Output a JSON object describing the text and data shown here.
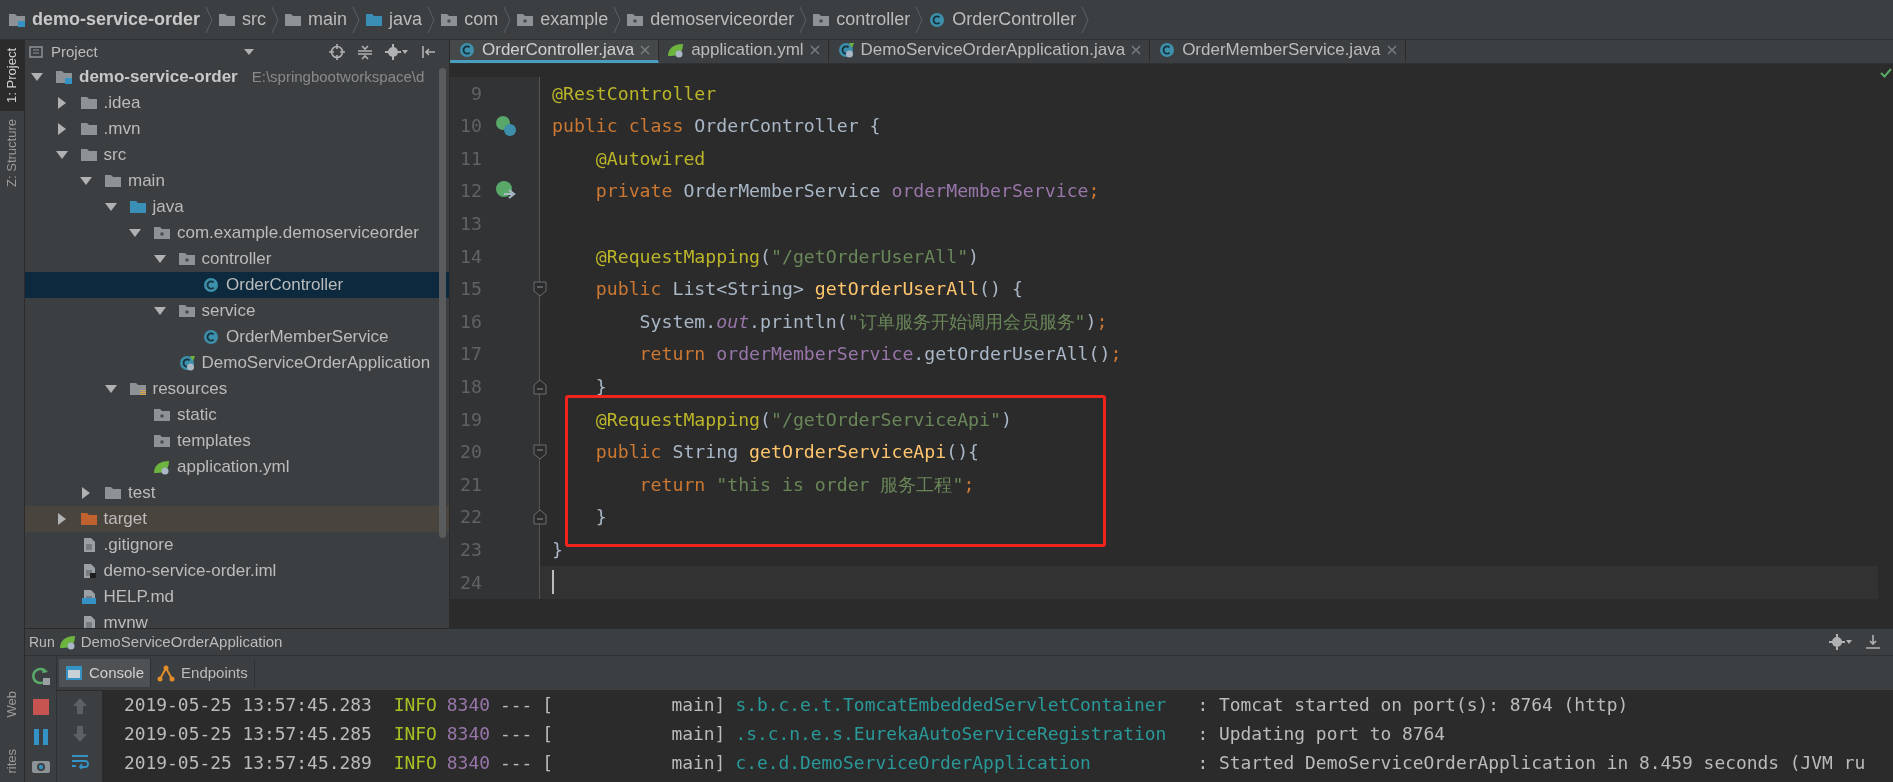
{
  "breadcrumbs": [
    {
      "label": "demo-service-order",
      "kind": "module"
    },
    {
      "label": "src",
      "kind": "folder"
    },
    {
      "label": "main",
      "kind": "folder"
    },
    {
      "label": "java",
      "kind": "source-folder"
    },
    {
      "label": "com",
      "kind": "package"
    },
    {
      "label": "example",
      "kind": "package"
    },
    {
      "label": "demoserviceorder",
      "kind": "package"
    },
    {
      "label": "controller",
      "kind": "package"
    },
    {
      "label": "OrderController",
      "kind": "class"
    }
  ],
  "tool_strip": {
    "top": [
      {
        "label": "1: Project",
        "selected": true
      },
      {
        "label": "Z: Structure",
        "selected": false
      }
    ],
    "bottom": [
      {
        "label": "Web",
        "selected": false
      },
      {
        "label": "rites",
        "selected": false
      }
    ]
  },
  "project": {
    "title": "Project",
    "tree": [
      {
        "label": "demo-service-order",
        "hint": "E:\\springbootworkspace\\d",
        "kind": "module",
        "expanded": true,
        "selected": false,
        "children": [
          {
            "label": ".idea",
            "kind": "folder",
            "expanded": false,
            "selected": false
          },
          {
            "label": ".mvn",
            "kind": "folder",
            "expanded": false,
            "selected": false
          },
          {
            "label": "src",
            "kind": "folder",
            "expanded": true,
            "selected": false,
            "children": [
              {
                "label": "main",
                "kind": "folder",
                "expanded": true,
                "selected": false,
                "children": [
                  {
                    "label": "java",
                    "kind": "source-folder",
                    "expanded": true,
                    "selected": false,
                    "children": [
                      {
                        "label": "com.example.demoserviceorder",
                        "kind": "package",
                        "expanded": true,
                        "selected": false,
                        "children": [
                          {
                            "label": "controller",
                            "kind": "package",
                            "expanded": true,
                            "selected": false,
                            "children": [
                              {
                                "label": "OrderController",
                                "kind": "class",
                                "selected": true
                              }
                            ]
                          },
                          {
                            "label": "service",
                            "kind": "package",
                            "expanded": true,
                            "selected": false,
                            "children": [
                              {
                                "label": "OrderMemberService",
                                "kind": "class",
                                "selected": false
                              }
                            ]
                          },
                          {
                            "label": "DemoServiceOrderApplication",
                            "kind": "spring-app",
                            "selected": false
                          }
                        ]
                      }
                    ]
                  },
                  {
                    "label": "resources",
                    "kind": "resources",
                    "expanded": true,
                    "selected": false,
                    "children": [
                      {
                        "label": "static",
                        "kind": "package",
                        "selected": false
                      },
                      {
                        "label": "templates",
                        "kind": "package",
                        "selected": false
                      },
                      {
                        "label": "application.yml",
                        "kind": "spring-file",
                        "selected": false
                      }
                    ]
                  }
                ]
              },
              {
                "label": "test",
                "kind": "folder",
                "expanded": false,
                "selected": false
              }
            ]
          },
          {
            "label": "target",
            "kind": "excluded",
            "expanded": false,
            "selected": false
          },
          {
            "label": ".gitignore",
            "kind": "file",
            "selected": false
          },
          {
            "label": "demo-service-order.iml",
            "kind": "iml",
            "selected": false
          },
          {
            "label": "HELP.md",
            "kind": "md",
            "selected": false
          },
          {
            "label": "mvnw",
            "kind": "file",
            "selected": false
          }
        ]
      }
    ]
  },
  "editor": {
    "tabs": [
      {
        "label": "OrderController.java",
        "kind": "class",
        "selected": true
      },
      {
        "label": "application.yml",
        "kind": "spring-file",
        "selected": false
      },
      {
        "label": "DemoServiceOrderApplication.java",
        "kind": "spring-app",
        "selected": false
      },
      {
        "label": "OrderMemberService.java",
        "kind": "class",
        "selected": false
      }
    ],
    "lines": [
      {
        "number": "9",
        "highlighted": false,
        "current": false,
        "tokens": [
          {
            "kind": "annotation",
            "text": "@RestController"
          }
        ]
      },
      {
        "number": "10",
        "highlighted": false,
        "current": false,
        "kind": "bean",
        "tokens": [
          {
            "kind": "keyword",
            "text": "public class "
          },
          {
            "kind": "plain",
            "text": "OrderController {"
          }
        ]
      },
      {
        "number": "11",
        "highlighted": false,
        "current": false,
        "tokens": [
          {
            "kind": "annotation",
            "text": "    @Autowired"
          }
        ]
      },
      {
        "number": "12",
        "highlighted": false,
        "current": false,
        "kind": "injection",
        "tokens": [
          {
            "kind": "keyword",
            "text": "    private "
          },
          {
            "kind": "plain",
            "text": "OrderMemberService "
          },
          {
            "kind": "field",
            "text": "orderMemberService"
          },
          {
            "kind": "keyword",
            "text": ";"
          }
        ]
      },
      {
        "number": "13",
        "highlighted": false,
        "current": false
      },
      {
        "number": "14",
        "highlighted": false,
        "current": false,
        "tokens": [
          {
            "kind": "annotation",
            "text": "    @RequestMapping"
          },
          {
            "kind": "plain",
            "text": "("
          },
          {
            "kind": "string",
            "text": "\"/getOrderUserAll\""
          },
          {
            "kind": "plain",
            "text": ")"
          }
        ]
      },
      {
        "number": "15",
        "highlighted": false,
        "current": false,
        "kind": "fold-start",
        "tokens": [
          {
            "kind": "keyword",
            "text": "    public "
          },
          {
            "kind": "plain",
            "text": "List<String> "
          },
          {
            "kind": "method",
            "text": "getOrderUserAll"
          },
          {
            "kind": "plain",
            "text": "() {"
          }
        ]
      },
      {
        "number": "16",
        "highlighted": false,
        "current": false,
        "tokens": [
          {
            "kind": "plain",
            "text": "        System."
          },
          {
            "kind": "static",
            "text": "out"
          },
          {
            "kind": "plain",
            "text": ".println("
          },
          {
            "kind": "string",
            "text": "\"订单服务开始调用会员服务\""
          },
          {
            "kind": "plain",
            "text": ")"
          },
          {
            "kind": "keyword",
            "text": ";"
          }
        ]
      },
      {
        "number": "17",
        "highlighted": false,
        "current": false,
        "tokens": [
          {
            "kind": "keyword",
            "text": "        return "
          },
          {
            "kind": "field",
            "text": "orderMemberService"
          },
          {
            "kind": "plain",
            "text": ".getOrderUserAll()"
          },
          {
            "kind": "keyword",
            "text": ";"
          }
        ]
      },
      {
        "number": "18",
        "highlighted": false,
        "current": false,
        "kind": "fold-end",
        "tokens": [
          {
            "kind": "plain",
            "text": "    }"
          }
        ]
      },
      {
        "number": "19",
        "highlighted": true,
        "current": false,
        "tokens": [
          {
            "kind": "annotation",
            "text": "    @RequestMapping"
          },
          {
            "kind": "plain",
            "text": "("
          },
          {
            "kind": "string",
            "text": "\"/getOrderServiceApi\""
          },
          {
            "kind": "plain",
            "text": ")"
          }
        ]
      },
      {
        "number": "20",
        "highlighted": true,
        "current": false,
        "kind": "fold-start",
        "tokens": [
          {
            "kind": "keyword",
            "text": "    public "
          },
          {
            "kind": "plain",
            "text": "String "
          },
          {
            "kind": "method",
            "text": "getOrderServiceApi"
          },
          {
            "kind": "plain",
            "text": "(){"
          }
        ]
      },
      {
        "number": "21",
        "highlighted": true,
        "current": false,
        "tokens": [
          {
            "kind": "keyword",
            "text": "        return "
          },
          {
            "kind": "string",
            "text": "\"this is order 服务工程\""
          },
          {
            "kind": "keyword",
            "text": ";"
          }
        ]
      },
      {
        "number": "22",
        "highlighted": true,
        "current": false,
        "kind": "fold-end",
        "tokens": [
          {
            "kind": "plain",
            "text": "    }"
          }
        ]
      },
      {
        "number": "23",
        "highlighted": false,
        "current": false,
        "tokens": [
          {
            "kind": "plain",
            "text": "}"
          }
        ]
      },
      {
        "number": "24",
        "highlighted": false,
        "current": true
      }
    ]
  },
  "run": {
    "label": "Run",
    "config": "DemoServiceOrderApplication",
    "tabs": [
      {
        "label": "Console",
        "selected": true
      },
      {
        "label": "Endpoints",
        "selected": false
      }
    ],
    "log": [
      {
        "timestamp": "2019-05-25 13:57:45.283",
        "level": "INFO",
        "pid": "8340",
        "separator": "---",
        "thread": "[           main]",
        "logger": "s.b.c.e.t.TomcatEmbeddedServletContainer",
        "message": ": Tomcat started on port(s): 8764 (http)"
      },
      {
        "timestamp": "2019-05-25 13:57:45.285",
        "level": "INFO",
        "pid": "8340",
        "separator": "---",
        "thread": "[           main]",
        "logger": ".s.c.n.e.s.EurekaAutoServiceRegistration",
        "message": ": Updating port to 8764"
      },
      {
        "timestamp": "2019-05-25 13:57:45.289",
        "level": "INFO",
        "pid": "8340",
        "separator": "---",
        "thread": "[           main]",
        "logger": "c.e.d.DemoServiceOrderApplication",
        "message": ": Started DemoServiceOrderApplication in 8.459 seconds (JVM ru"
      }
    ]
  }
}
